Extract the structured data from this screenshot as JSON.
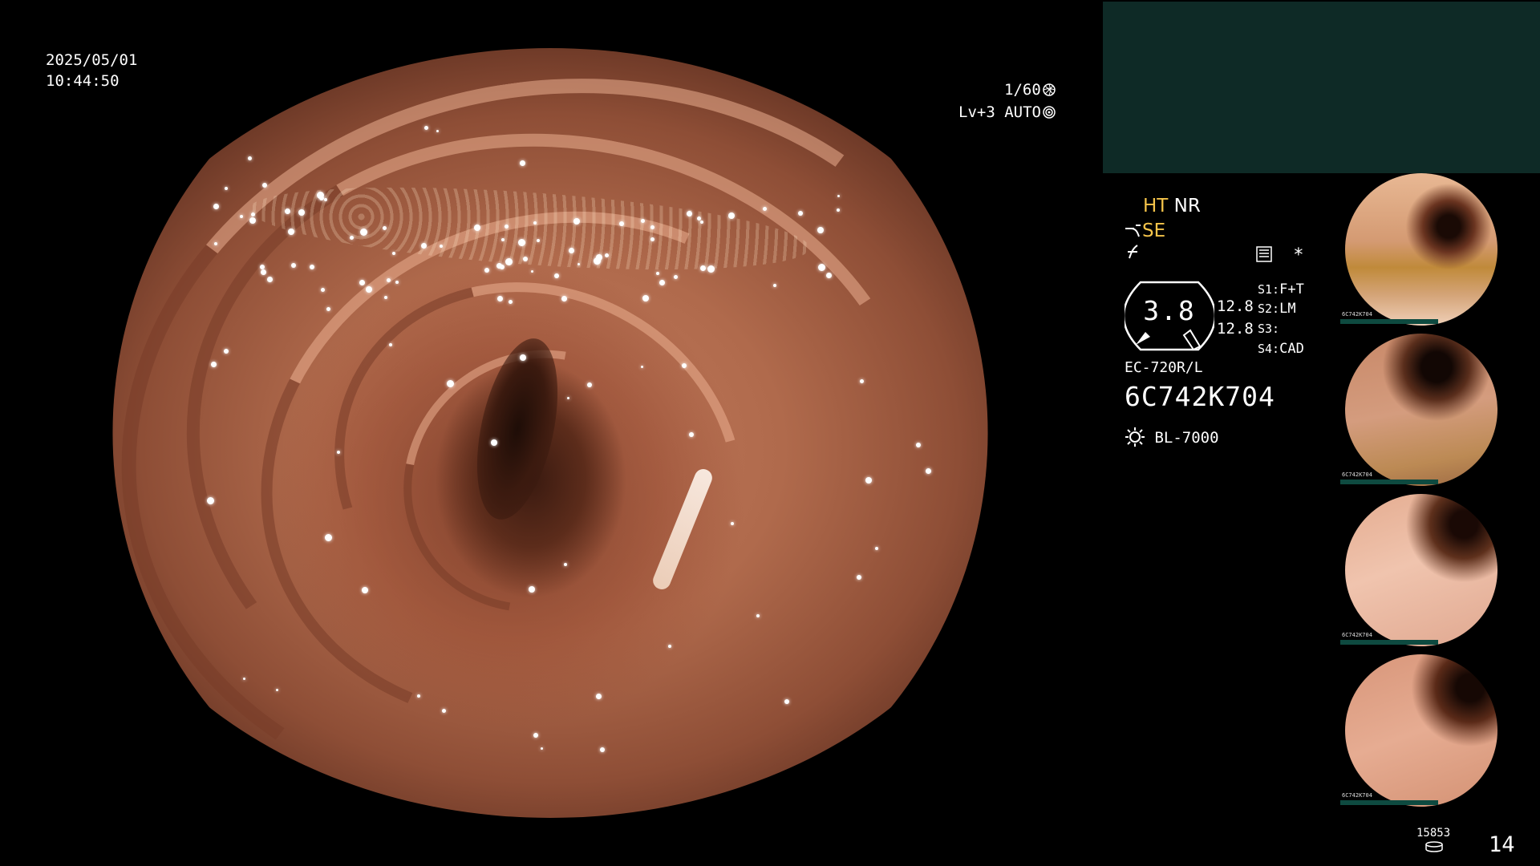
{
  "overlay": {
    "date": "2025/05/01",
    "time": "10:44:50",
    "shutter": "1/60",
    "level": "Lv+3 AUTO"
  },
  "info": {
    "ht": "HT",
    "nr": "NR",
    "se": "SE",
    "gauge_value": "3.8",
    "gauge_num1": "12.8",
    "gauge_num2": "12.8",
    "s1_tag": "S1:",
    "s1_val": "F+T",
    "s2_tag": "S2:",
    "s2_val": "LM",
    "s3_tag": "S3:",
    "s3_val": "",
    "s4_tag": "S4:",
    "s4_val": "CAD",
    "scope_model": "EC-720R/L",
    "scope_serial": "6C742K704",
    "light_source": "BL-7000",
    "asterisk": "*"
  },
  "footer": {
    "counter": "15853",
    "page": "14"
  },
  "thumbnails": [
    {
      "label": "6C742K704"
    },
    {
      "label": "6C742K704"
    },
    {
      "label": "6C742K704"
    },
    {
      "label": "6C742K704"
    }
  ],
  "colors": {
    "accent_yellow": "#f5c44a",
    "panel_teal": "#0e2a26",
    "mucosa": "#b06a4c"
  },
  "icons": [
    "shutter-icon",
    "auto-iris-icon",
    "scope-icon",
    "freeze-icon",
    "memory-icon",
    "light-source-icon",
    "storage-icon"
  ]
}
